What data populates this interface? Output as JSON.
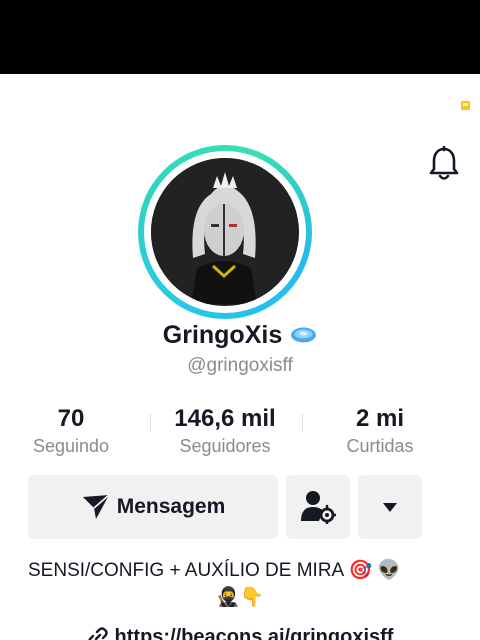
{
  "profile": {
    "name": "GringoXis",
    "handle": "@gringoxisff",
    "badge_icon": "disc-badge-icon"
  },
  "stats": [
    {
      "value": "70",
      "label": "Seguindo"
    },
    {
      "value": "146,6 mil",
      "label": "Seguidores"
    },
    {
      "value": "2 mi",
      "label": "Curtidas"
    }
  ],
  "actions": {
    "message_label": "Mensagem",
    "message_icon": "send-icon",
    "add_friend_icon": "user-settings-icon",
    "more_icon": "caret-down-icon"
  },
  "header": {
    "notification_icon": "bell-icon"
  },
  "bio": {
    "line1": "SENSI/CONFIG + AUXÍLIO DE MIRA 🎯 👽",
    "line2": "🥷👇"
  },
  "link": {
    "text": "https://beacons.ai/gringoxisff",
    "icon": "link-icon"
  },
  "colors": {
    "ring_start": "#25c8e8",
    "ring_end": "#38e0b0",
    "text_secondary": "#8a8b91",
    "button_bg": "#f1f1f2"
  }
}
